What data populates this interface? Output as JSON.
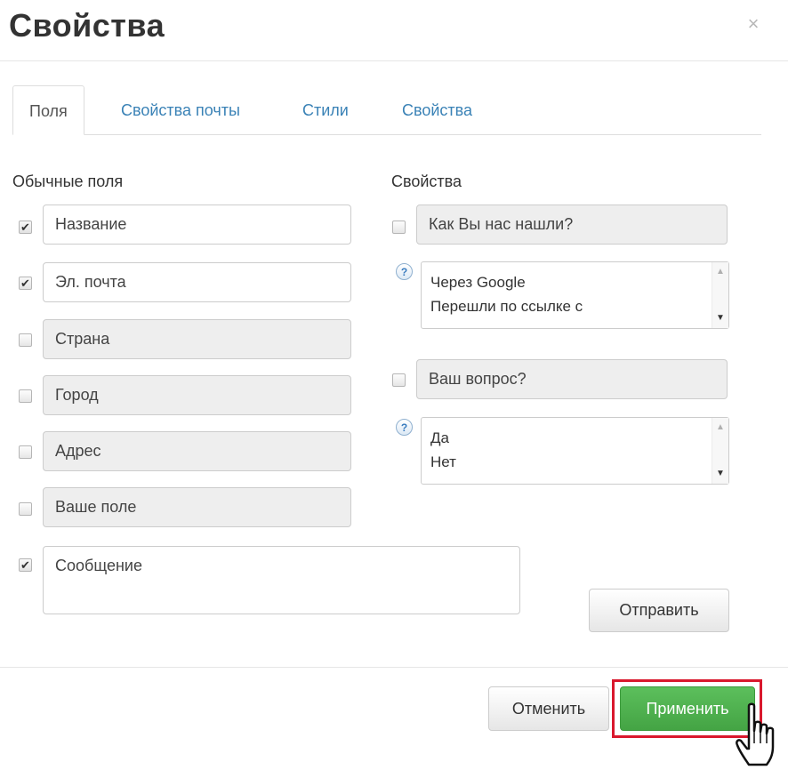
{
  "dialog": {
    "title": "Свойства",
    "close_glyph": "×"
  },
  "tabs": [
    {
      "label": "Поля",
      "active": true
    },
    {
      "label": "Свойства почты",
      "active": false
    },
    {
      "label": "Стили",
      "active": false
    },
    {
      "label": "Свойства",
      "active": false
    }
  ],
  "left_section": {
    "label": "Обычные поля",
    "fields": [
      {
        "label": "Название",
        "checked": true
      },
      {
        "label": "Эл. почта",
        "checked": true
      },
      {
        "label": "Страна",
        "checked": false
      },
      {
        "label": "Город",
        "checked": false
      },
      {
        "label": "Адрес",
        "checked": false
      },
      {
        "label": "Ваше поле",
        "checked": false
      },
      {
        "label": "Сообщение",
        "checked": true
      }
    ]
  },
  "right_section": {
    "label": "Свойства",
    "question1": {
      "label": "Как Вы нас нашли?",
      "checked": false,
      "options": [
        "Через Google",
        "Перешли по ссылке с"
      ]
    },
    "question2": {
      "label": "Ваш вопрос?",
      "checked": false,
      "options": [
        "Да",
        "Нет"
      ]
    },
    "help_glyph": "?",
    "submit_label": "Отправить"
  },
  "footer": {
    "cancel_label": "Отменить",
    "apply_label": "Применить"
  },
  "icons": {
    "check": "✔",
    "scroll_up": "▲",
    "scroll_down": "▼"
  },
  "colors": {
    "accent_link": "#3a82b6",
    "apply_green": "#4cae4c",
    "highlight_red": "#d9182d"
  }
}
